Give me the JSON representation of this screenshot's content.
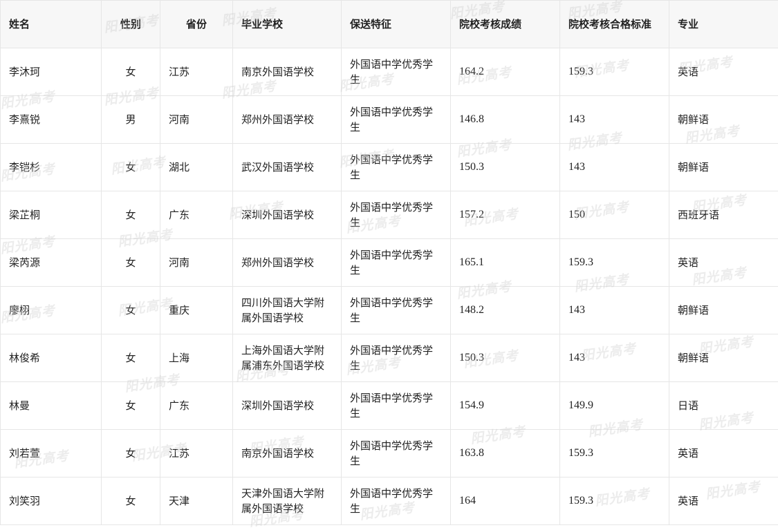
{
  "table": {
    "headers": [
      "姓名",
      "性别",
      "省份",
      "毕业学校",
      "保送特征",
      "院校考核成绩",
      "院校考核合格标准",
      "专业"
    ],
    "rows": [
      [
        "李沐珂",
        "女",
        "江苏",
        "南京外国语学校",
        "外国语中学优秀学生",
        "164.2",
        "159.3",
        "英语"
      ],
      [
        "李熹锐",
        "男",
        "河南",
        "郑州外国语学校",
        "外国语中学优秀学生",
        "146.8",
        "143",
        "朝鲜语"
      ],
      [
        "李铠杉",
        "女",
        "湖北",
        "武汉外国语学校",
        "外国语中学优秀学生",
        "150.3",
        "143",
        "朝鲜语"
      ],
      [
        "梁芷桐",
        "女",
        "广东",
        "深圳外国语学校",
        "外国语中学优秀学生",
        "157.2",
        "150",
        "西班牙语"
      ],
      [
        "梁芮源",
        "女",
        "河南",
        "郑州外国语学校",
        "外国语中学优秀学生",
        "165.1",
        "159.3",
        "英语"
      ],
      [
        "廖栩",
        "女",
        "重庆",
        "四川外国语大学附属外国语学校",
        "外国语中学优秀学生",
        "148.2",
        "143",
        "朝鲜语"
      ],
      [
        "林俊希",
        "女",
        "上海",
        "上海外国语大学附属浦东外国语学校",
        "外国语中学优秀学生",
        "150.3",
        "143",
        "朝鲜语"
      ],
      [
        "林曼",
        "女",
        "广东",
        "深圳外国语学校",
        "外国语中学优秀学生",
        "154.9",
        "149.9",
        "日语"
      ],
      [
        "刘若萱",
        "女",
        "江苏",
        "南京外国语学校",
        "外国语中学优秀学生",
        "163.8",
        "159.3",
        "英语"
      ],
      [
        "刘笑羽",
        "女",
        "天津",
        "天津外国语大学附属外国语学校",
        "外国语中学优秀学生",
        "164",
        "159.3",
        "英语"
      ]
    ]
  },
  "watermark": {
    "text": "阳光高考"
  }
}
